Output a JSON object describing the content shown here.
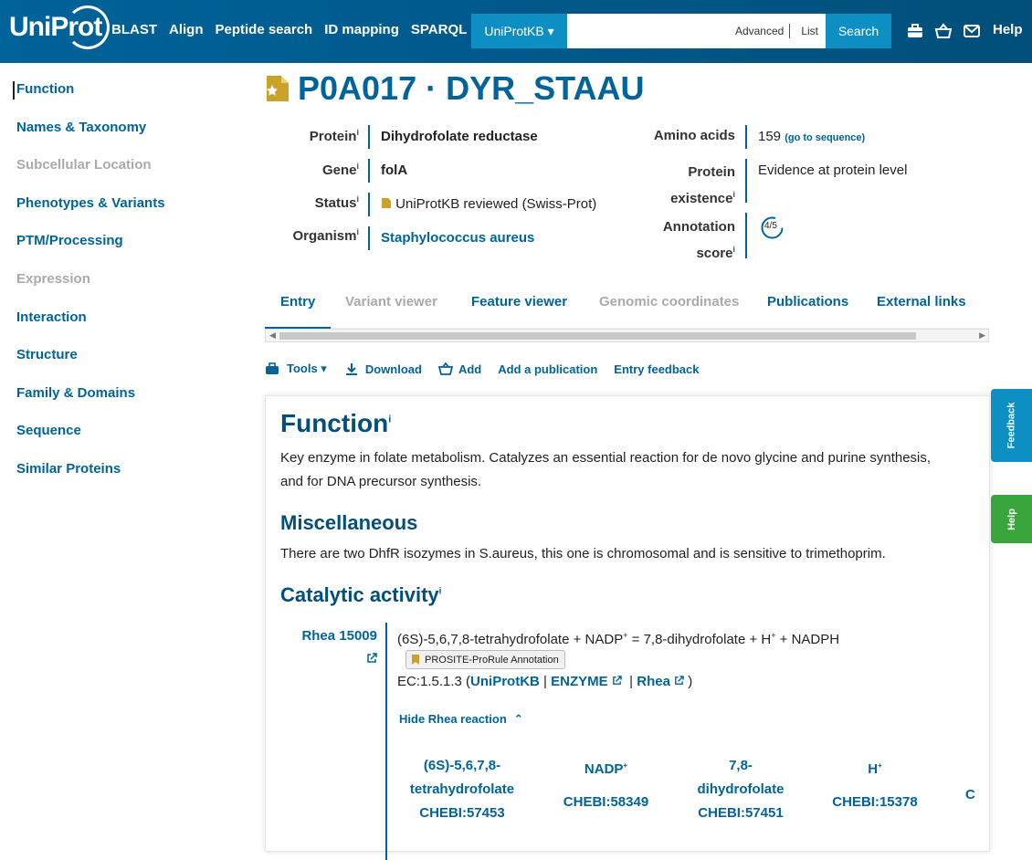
{
  "header": {
    "logo": "UniProt",
    "nav": [
      "BLAST",
      "Align",
      "Peptide search",
      "ID mapping",
      "SPARQL"
    ],
    "db_select": "UniProtKB ▾",
    "search_advanced": "Advanced",
    "search_list": "List",
    "search_button": "Search",
    "help": "Help"
  },
  "sidebar": {
    "items": [
      {
        "label": "Function"
      },
      {
        "label": "Names & Taxonomy"
      },
      {
        "label": "Subcellular Location"
      },
      {
        "label": "Phenotypes & Variants"
      },
      {
        "label": "PTM/Processing"
      },
      {
        "label": "Expression"
      },
      {
        "label": "Interaction"
      },
      {
        "label": "Structure"
      },
      {
        "label": "Family & Domains"
      },
      {
        "label": "Sequence"
      },
      {
        "label": "Similar Proteins"
      }
    ]
  },
  "entry": {
    "title": "P0A017 · DYR_STAAU",
    "protein_key": "Protein",
    "protein": "Dihydrofolate reductase",
    "gene_key": "Gene",
    "gene": "folA",
    "status_key": "Status",
    "status": "UniProtKB reviewed (Swiss-Prot)",
    "organism_key": "Organism",
    "organism": "Staphylococcus aureus",
    "amino_key": "Amino acids",
    "amino": "159",
    "amino_link": "(go to sequence)",
    "existence_key1": "Protein",
    "existence_key2": "existence",
    "existence": "Evidence at protein level",
    "score_key1": "Annotation",
    "score_key2": "score",
    "score": "4/5",
    "info": "i"
  },
  "tabs": [
    "Entry",
    "Variant viewer",
    "Feature viewer",
    "Genomic coordinates",
    "Publications",
    "External links"
  ],
  "toolbar": {
    "tools": "Tools ▾",
    "download": "Download",
    "add": "Add",
    "add_publication": "Add a publication",
    "feedback": "Entry feedback"
  },
  "function": {
    "heading": "Function",
    "text1": "Key enzyme in folate metabolism. Catalyzes an essential reaction for de novo glycine and purine synthesis,",
    "text2": "and for DNA precursor synthesis.",
    "misc_heading": "Miscellaneous",
    "misc_text": "There are two DhfR isozymes in S.aureus, this one is chromosomal and is sensitive to trimethoprim.",
    "cat_heading": "Catalytic activity",
    "rhea_id": "Rhea 15009",
    "reaction": "(6S)-5,6,7,8-tetrahydrofolate + NADP",
    "reaction_sup1": "+",
    "reaction_mid": " = 7,8-dihydrofolate + H",
    "reaction_sup2": "+",
    "reaction_end": " + NADPH",
    "badge": "PROSITE-ProRule Annotation",
    "ec_prefix": "EC:1.5.1.3 (",
    "ec_uniprot": "UniProtKB",
    "ec_pipe": "|",
    "ec_enzyme": "ENZYME",
    "ec_rhea": "Rhea",
    "ec_close": ")",
    "hide_rhea": "Hide Rhea reaction",
    "compounds": [
      {
        "name1": "(6S)-5,6,7,8-",
        "name2": "tetrahydrofolate",
        "chebi": "CHEBI:57453"
      },
      {
        "name1": "NADP",
        "sup": "+",
        "name2": "",
        "chebi": "CHEBI:58349"
      },
      {
        "name1": "7,8-",
        "name2": "dihydrofolate",
        "chebi": "CHEBI:57451"
      },
      {
        "name1": "H",
        "sup": "+",
        "name2": "",
        "chebi": "CHEBI:15378"
      }
    ],
    "cut_letter": "C"
  },
  "side_tabs": {
    "feedback": "Feedback",
    "help": "Help"
  },
  "colors": {
    "brand": "#00639a",
    "accent": "#0d8fc4",
    "gold": "#c9a227",
    "help_tab": "#3aa53a"
  }
}
